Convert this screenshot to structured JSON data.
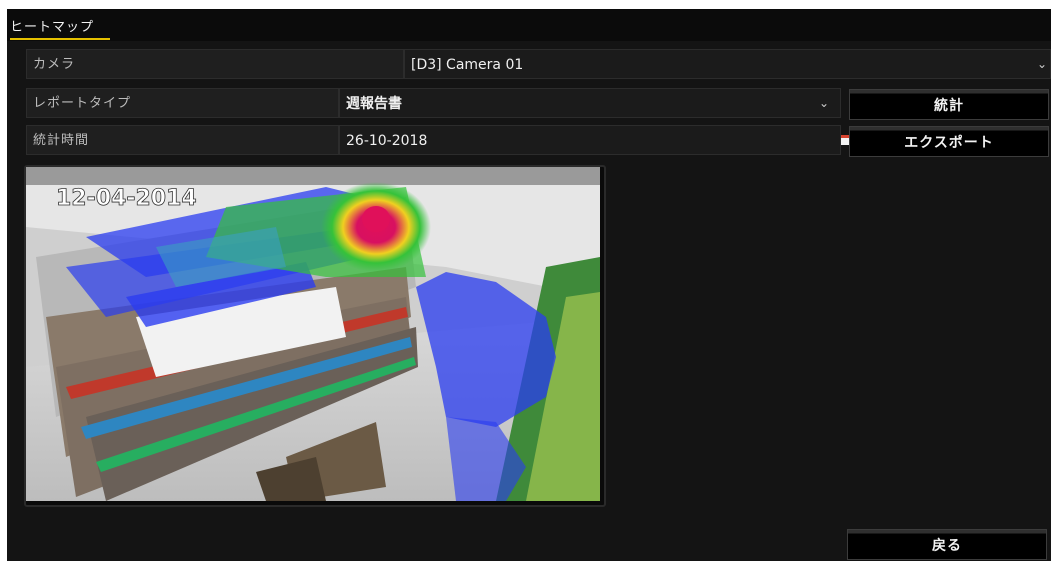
{
  "tab": {
    "label": "ヒートマップ"
  },
  "form": {
    "camera": {
      "label": "カメラ",
      "value": "[D3] Camera 01"
    },
    "report_type": {
      "label": "レポートタイプ",
      "value": "週報告書"
    },
    "stat_time": {
      "label": "統計時間",
      "value": "26-10-2018"
    }
  },
  "buttons": {
    "statistics": "統計",
    "export": "エクスポート",
    "back": "戻る"
  },
  "preview": {
    "timestamp": "12-04-2014"
  },
  "colors": {
    "accent_tab": "#e5c100",
    "heat_high": "#e0105a",
    "heat_mid": "#35c23a",
    "heat_low": "#2a3cf0"
  }
}
